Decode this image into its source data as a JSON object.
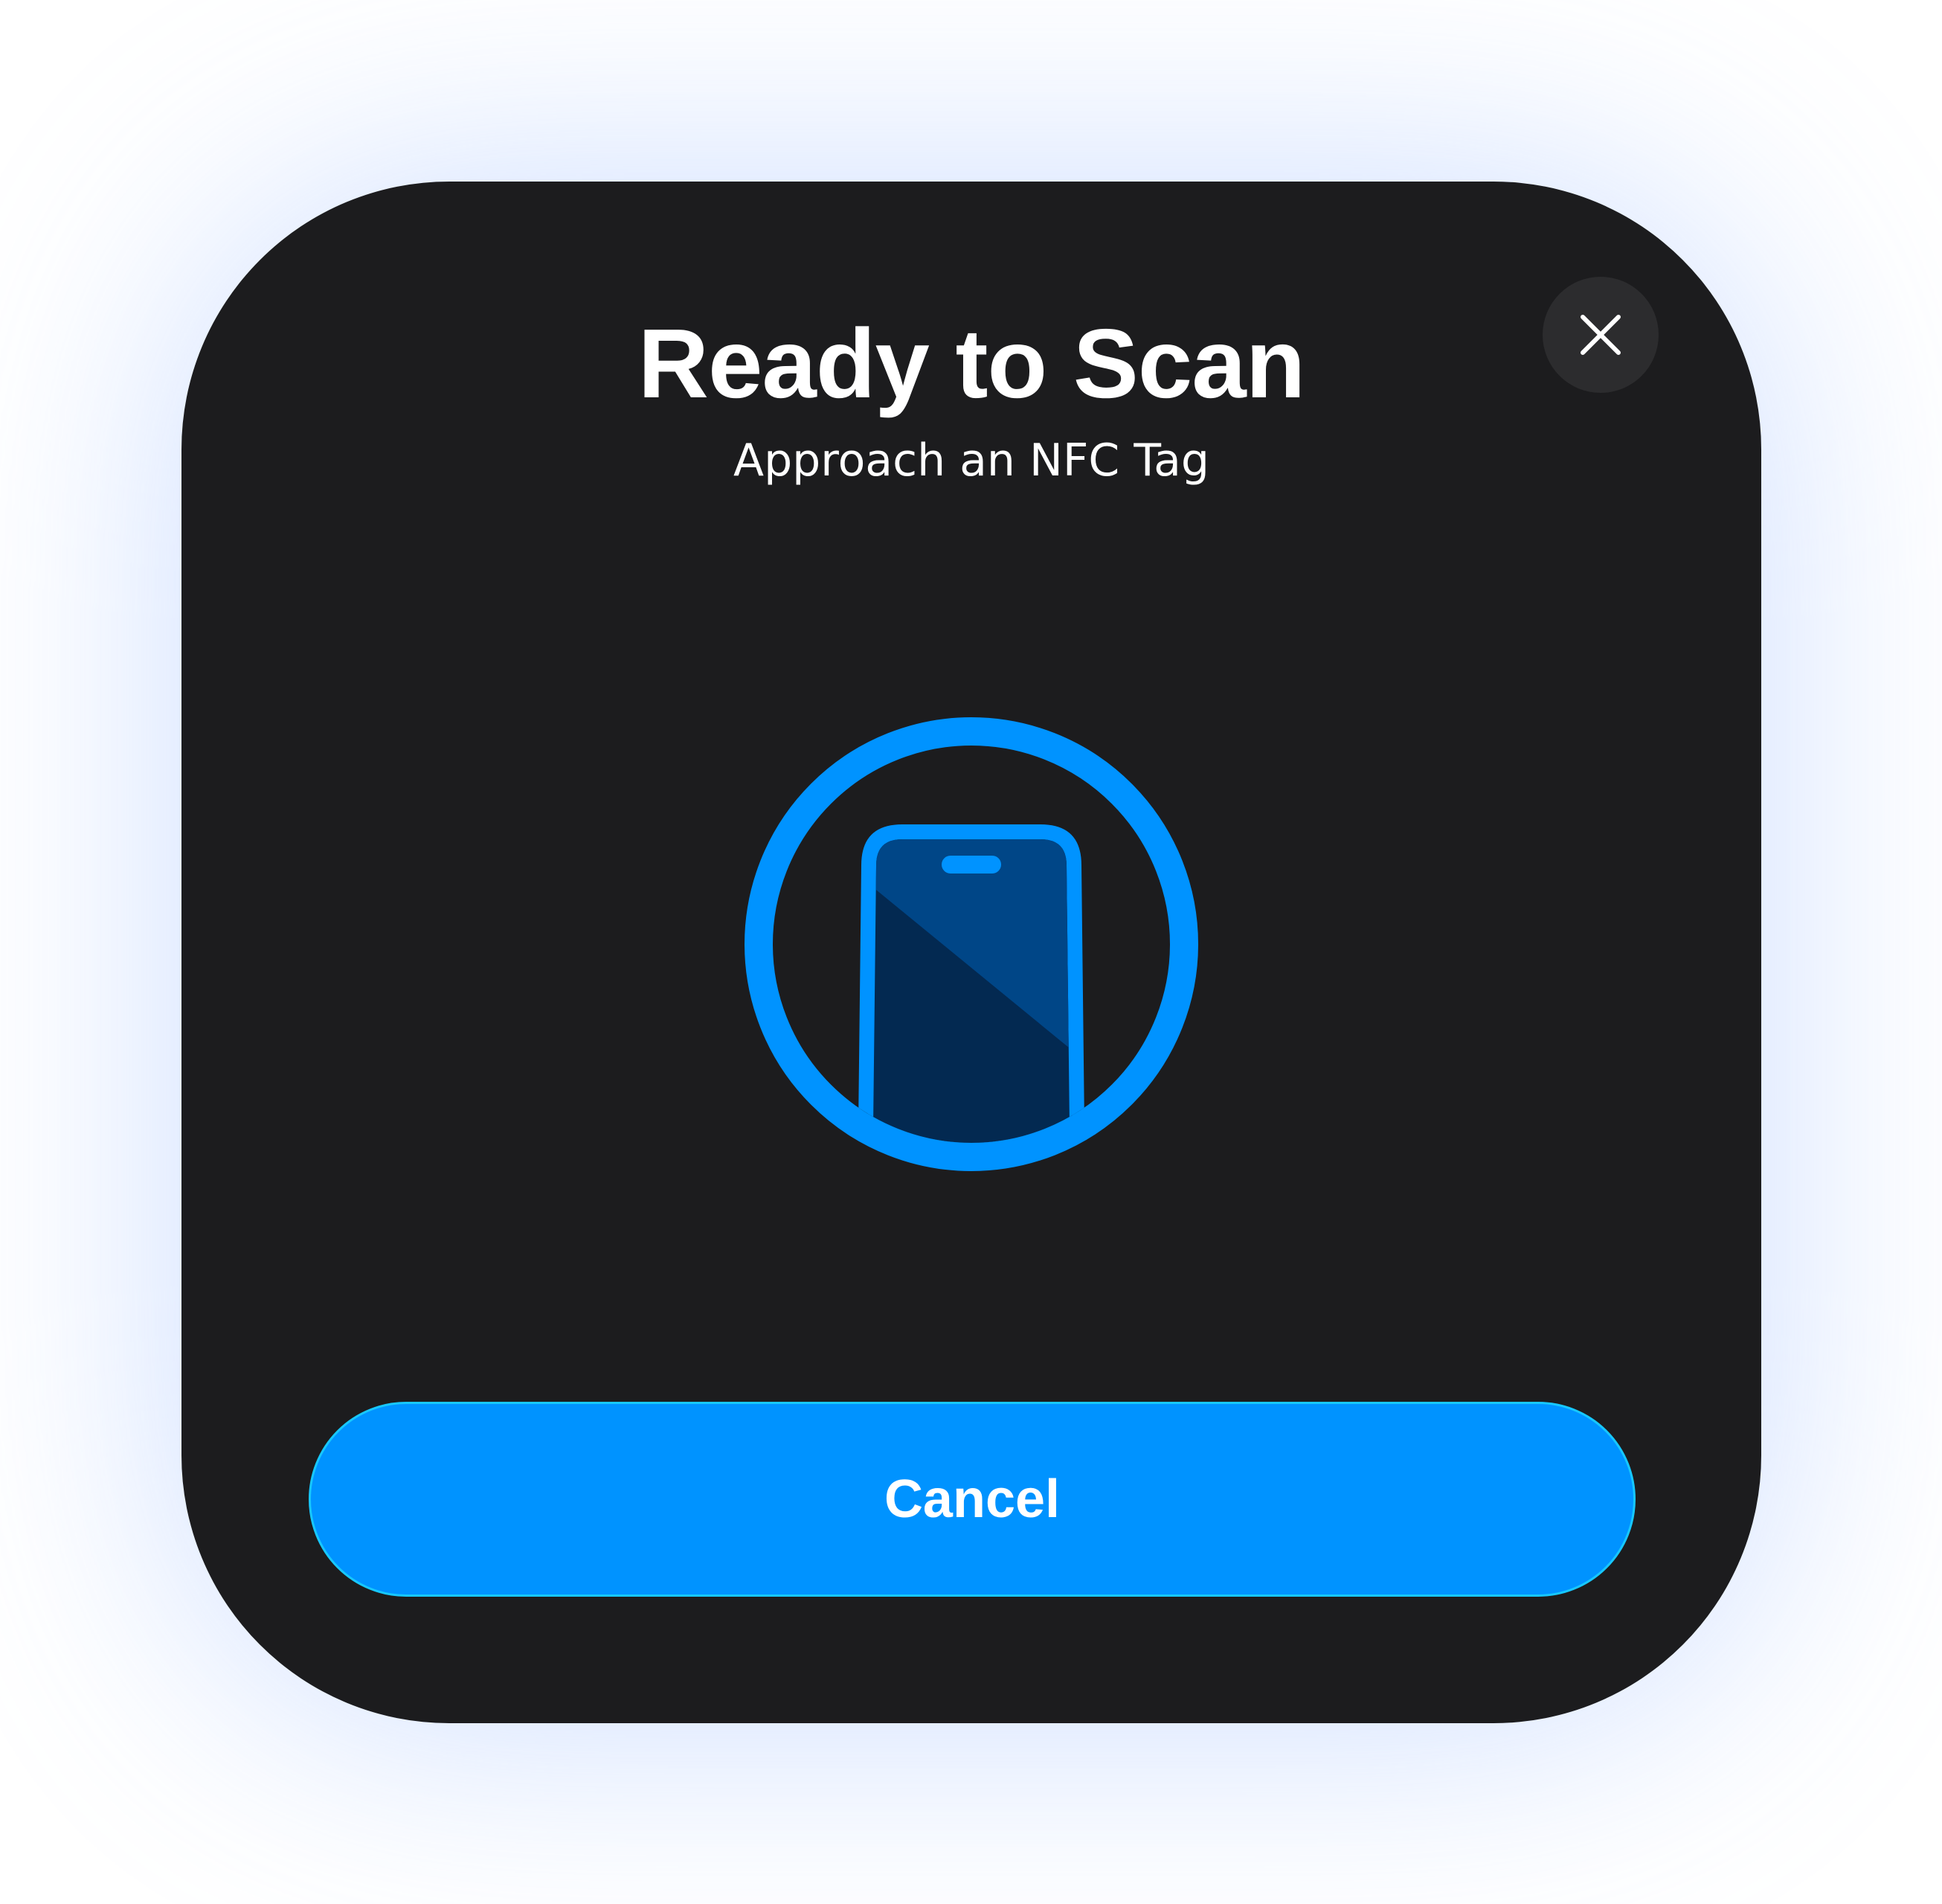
{
  "dialog": {
    "title": "Ready to Scan",
    "subtitle": "Approach an NFC Tag",
    "cancel_label": "Cancel"
  },
  "icons": {
    "close": "close-icon",
    "illustration": "nfc-phone-icon"
  },
  "colors": {
    "sheet_background": "#1c1c1e",
    "close_button_background": "#2c2c2e",
    "accent": "#0093ff",
    "accent_border": "#17c8ff",
    "phone_light": "#004687",
    "phone_dark": "#032951",
    "text": "#ffffff",
    "glow": "#8fb4ff"
  }
}
